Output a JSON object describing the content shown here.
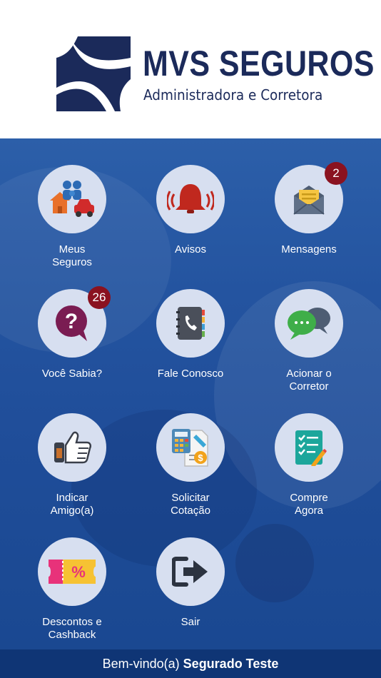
{
  "header": {
    "brand_title": "MVS SEGUROS",
    "brand_subtitle": "Administradora e Corretora"
  },
  "menu": [
    {
      "label_line1": "Meus",
      "label_line2": "Seguros",
      "icon": "family-house-car-icon",
      "badge": null
    },
    {
      "label_line1": "Avisos",
      "label_line2": "",
      "icon": "bell-alarm-icon",
      "badge": null
    },
    {
      "label_line1": "Mensagens",
      "label_line2": "",
      "icon": "envelope-icon",
      "badge": "2"
    },
    {
      "label_line1": "Você Sabia?",
      "label_line2": "",
      "icon": "question-bubble-icon",
      "badge": "26"
    },
    {
      "label_line1": "Fale Conosco",
      "label_line2": "",
      "icon": "phone-book-icon",
      "badge": null
    },
    {
      "label_line1": "Acionar o",
      "label_line2": "Corretor",
      "icon": "chat-bubbles-icon",
      "badge": null
    },
    {
      "label_line1": "Indicar",
      "label_line2": "Amigo(a)",
      "icon": "thumbs-up-icon",
      "badge": null
    },
    {
      "label_line1": "Solicitar",
      "label_line2": "Cotação",
      "icon": "calculator-quote-icon",
      "badge": null
    },
    {
      "label_line1": "Compre",
      "label_line2": "Agora",
      "icon": "checklist-icon",
      "badge": null
    },
    {
      "label_line1": "Descontos e",
      "label_line2": "Cashback",
      "icon": "discount-ticket-icon",
      "badge": null
    },
    {
      "label_line1": "Sair",
      "label_line2": "",
      "icon": "exit-arrow-icon",
      "badge": null
    }
  ],
  "footer": {
    "greeting": "Bem-vindo(a)",
    "user_name": "Segurado Teste"
  },
  "colors": {
    "brand_navy": "#1b2a5a",
    "background_blue": "#2454a0",
    "footer_blue": "#0f3575",
    "badge_red": "#8a1220",
    "tile_circle": "#d7dff0"
  }
}
